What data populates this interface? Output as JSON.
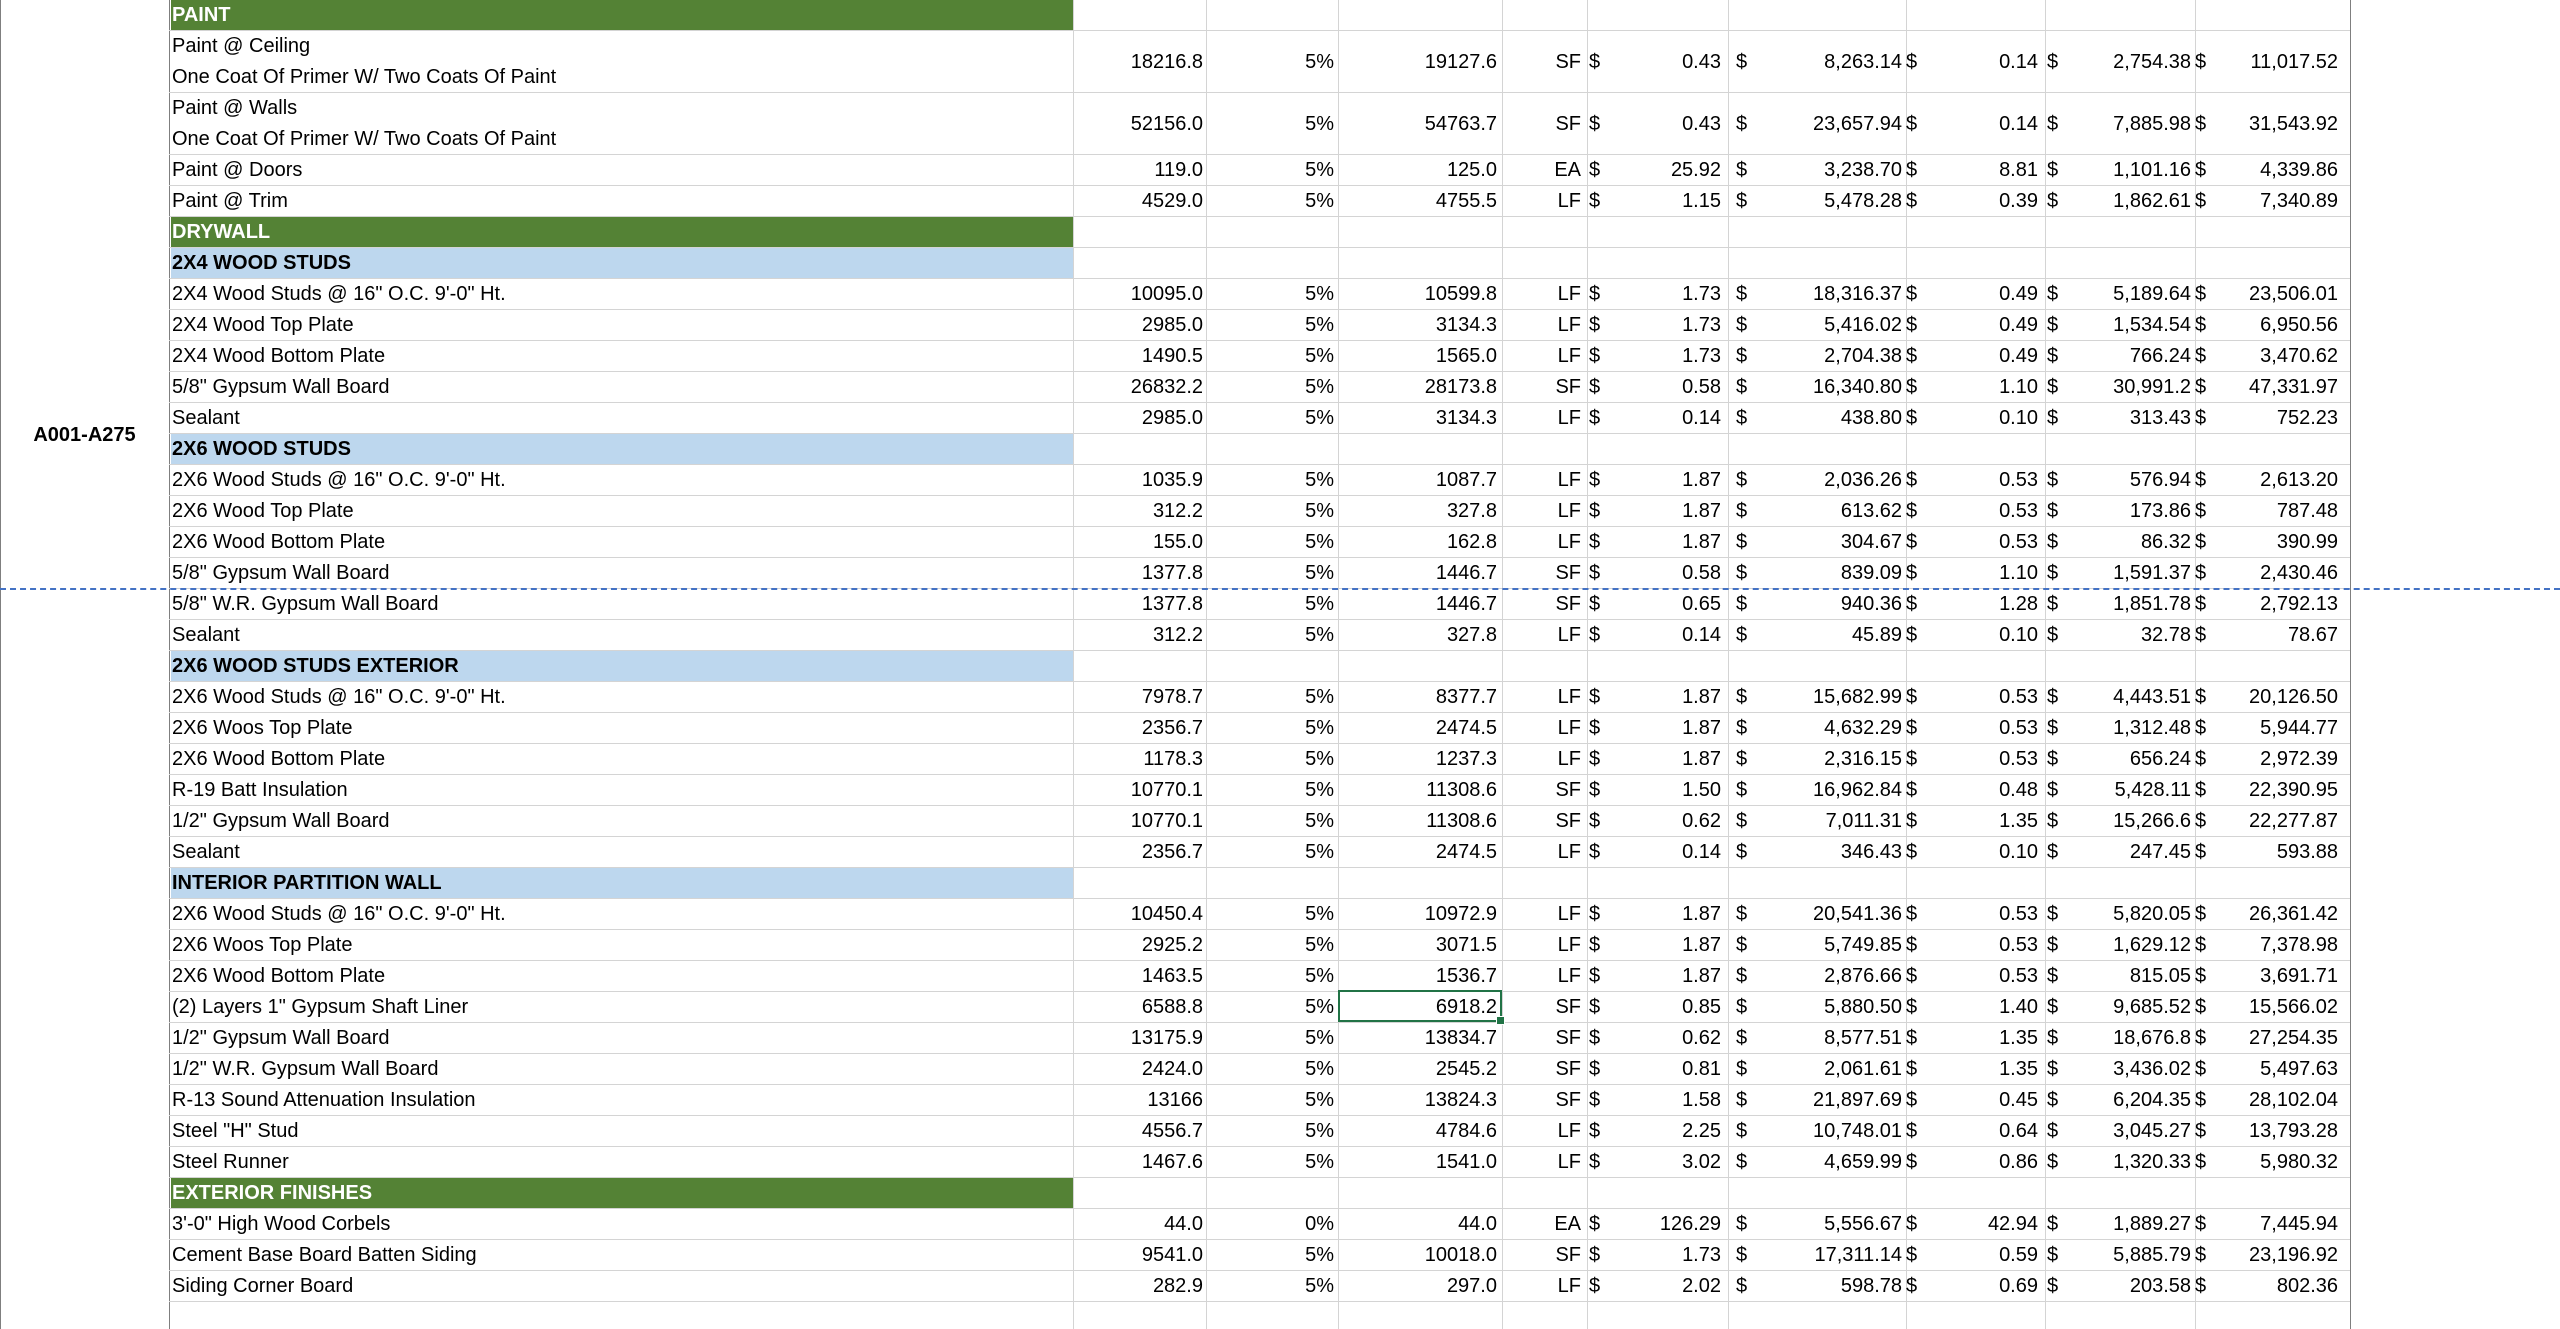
{
  "sheet": {
    "section_label": "A001-A275",
    "rows": [
      {
        "type": "header",
        "desc": "PAINT"
      },
      {
        "type": "item",
        "desc": "Paint @ Ceiling",
        "desc2": "One Coat Of Primer W/ Two Coats Of Paint",
        "qty": "18216.8",
        "waste": "5%",
        "total": "19127.6",
        "unit": "SF",
        "mat_unit": "0.43",
        "mat_total": "8,263.14",
        "lab_unit": "0.14",
        "lab_total": "2,754.38",
        "grand": "11,017.52"
      },
      {
        "type": "item",
        "desc": "Paint @ Walls",
        "desc2": "One Coat Of Primer W/ Two Coats Of Paint",
        "qty": "52156.0",
        "waste": "5%",
        "total": "54763.7",
        "unit": "SF",
        "mat_unit": "0.43",
        "mat_total": "23,657.94",
        "lab_unit": "0.14",
        "lab_total": "7,885.98",
        "grand": "31,543.92"
      },
      {
        "type": "item",
        "desc": "Paint @ Doors",
        "qty": "119.0",
        "waste": "5%",
        "total": "125.0",
        "unit": "EA",
        "mat_unit": "25.92",
        "mat_total": "3,238.70",
        "lab_unit": "8.81",
        "lab_total": "1,101.16",
        "grand": "4,339.86"
      },
      {
        "type": "item",
        "desc": "Paint @ Trim",
        "qty": "4529.0",
        "waste": "5%",
        "total": "4755.5",
        "unit": "LF",
        "mat_unit": "1.15",
        "mat_total": "5,478.28",
        "lab_unit": "0.39",
        "lab_total": "1,862.61",
        "grand": "7,340.89"
      },
      {
        "type": "header",
        "desc": "DRYWALL"
      },
      {
        "type": "sub",
        "desc": "2X4 WOOD STUDS"
      },
      {
        "type": "item",
        "desc": "2X4 Wood Studs @ 16\" O.C. 9'-0\" Ht.",
        "qty": "10095.0",
        "waste": "5%",
        "total": "10599.8",
        "unit": "LF",
        "mat_unit": "1.73",
        "mat_total": "18,316.37",
        "lab_unit": "0.49",
        "lab_total": "5,189.64",
        "grand": "23,506.01"
      },
      {
        "type": "item",
        "desc": "2X4 Wood Top Plate",
        "qty": "2985.0",
        "waste": "5%",
        "total": "3134.3",
        "unit": "LF",
        "mat_unit": "1.73",
        "mat_total": "5,416.02",
        "lab_unit": "0.49",
        "lab_total": "1,534.54",
        "grand": "6,950.56"
      },
      {
        "type": "item",
        "desc": "2X4 Wood Bottom Plate",
        "qty": "1490.5",
        "waste": "5%",
        "total": "1565.0",
        "unit": "LF",
        "mat_unit": "1.73",
        "mat_total": "2,704.38",
        "lab_unit": "0.49",
        "lab_total": "766.24",
        "grand": "3,470.62"
      },
      {
        "type": "item",
        "desc": "5/8\" Gypsum Wall Board",
        "qty": "26832.2",
        "waste": "5%",
        "total": "28173.8",
        "unit": "SF",
        "mat_unit": "0.58",
        "mat_total": "16,340.80",
        "lab_unit": "1.10",
        "lab_total": "30,991.2",
        "grand": "47,331.97"
      },
      {
        "type": "item",
        "desc": "Sealant",
        "qty": "2985.0",
        "waste": "5%",
        "total": "3134.3",
        "unit": "LF",
        "mat_unit": "0.14",
        "mat_total": "438.80",
        "lab_unit": "0.10",
        "lab_total": "313.43",
        "grand": "752.23"
      },
      {
        "type": "sub",
        "desc": "2X6 WOOD STUDS"
      },
      {
        "type": "item",
        "desc": "2X6 Wood Studs @ 16\" O.C. 9'-0\" Ht.",
        "qty": "1035.9",
        "waste": "5%",
        "total": "1087.7",
        "unit": "LF",
        "mat_unit": "1.87",
        "mat_total": "2,036.26",
        "lab_unit": "0.53",
        "lab_total": "576.94",
        "grand": "2,613.20"
      },
      {
        "type": "item",
        "desc": "2X6 Wood Top Plate",
        "qty": "312.2",
        "waste": "5%",
        "total": "327.8",
        "unit": "LF",
        "mat_unit": "1.87",
        "mat_total": "613.62",
        "lab_unit": "0.53",
        "lab_total": "173.86",
        "grand": "787.48"
      },
      {
        "type": "item",
        "desc": "2X6 Wood Bottom Plate",
        "qty": "155.0",
        "waste": "5%",
        "total": "162.8",
        "unit": "LF",
        "mat_unit": "1.87",
        "mat_total": "304.67",
        "lab_unit": "0.53",
        "lab_total": "86.32",
        "grand": "390.99"
      },
      {
        "type": "item",
        "desc": "5/8\" Gypsum Wall Board",
        "qty": "1377.8",
        "waste": "5%",
        "total": "1446.7",
        "unit": "SF",
        "mat_unit": "0.58",
        "mat_total": "839.09",
        "lab_unit": "1.10",
        "lab_total": "1,591.37",
        "grand": "2,430.46"
      },
      {
        "type": "item",
        "desc": "5/8\" W.R. Gypsum Wall Board",
        "qty": "1377.8",
        "waste": "5%",
        "total": "1446.7",
        "unit": "SF",
        "mat_unit": "0.65",
        "mat_total": "940.36",
        "lab_unit": "1.28",
        "lab_total": "1,851.78",
        "grand": "2,792.13"
      },
      {
        "type": "item",
        "desc": "Sealant",
        "qty": "312.2",
        "waste": "5%",
        "total": "327.8",
        "unit": "LF",
        "mat_unit": "0.14",
        "mat_total": "45.89",
        "lab_unit": "0.10",
        "lab_total": "32.78",
        "grand": "78.67"
      },
      {
        "type": "sub",
        "desc": "2X6 WOOD STUDS EXTERIOR"
      },
      {
        "type": "item",
        "desc": "2X6 Wood Studs @ 16\" O.C. 9'-0\" Ht.",
        "qty": "7978.7",
        "waste": "5%",
        "total": "8377.7",
        "unit": "LF",
        "mat_unit": "1.87",
        "mat_total": "15,682.99",
        "lab_unit": "0.53",
        "lab_total": "4,443.51",
        "grand": "20,126.50"
      },
      {
        "type": "item",
        "desc": "2X6 Woos Top Plate",
        "qty": "2356.7",
        "waste": "5%",
        "total": "2474.5",
        "unit": "LF",
        "mat_unit": "1.87",
        "mat_total": "4,632.29",
        "lab_unit": "0.53",
        "lab_total": "1,312.48",
        "grand": "5,944.77"
      },
      {
        "type": "item",
        "desc": "2X6 Wood Bottom Plate",
        "qty": "1178.3",
        "waste": "5%",
        "total": "1237.3",
        "unit": "LF",
        "mat_unit": "1.87",
        "mat_total": "2,316.15",
        "lab_unit": "0.53",
        "lab_total": "656.24",
        "grand": "2,972.39"
      },
      {
        "type": "item",
        "desc": "R-19 Batt Insulation",
        "qty": "10770.1",
        "waste": "5%",
        "total": "11308.6",
        "unit": "SF",
        "mat_unit": "1.50",
        "mat_total": "16,962.84",
        "lab_unit": "0.48",
        "lab_total": "5,428.11",
        "grand": "22,390.95"
      },
      {
        "type": "item",
        "desc": "1/2\" Gypsum Wall Board",
        "qty": "10770.1",
        "waste": "5%",
        "total": "11308.6",
        "unit": "SF",
        "mat_unit": "0.62",
        "mat_total": "7,011.31",
        "lab_unit": "1.35",
        "lab_total": "15,266.6",
        "grand": "22,277.87"
      },
      {
        "type": "item",
        "desc": "Sealant",
        "qty": "2356.7",
        "waste": "5%",
        "total": "2474.5",
        "unit": "LF",
        "mat_unit": "0.14",
        "mat_total": "346.43",
        "lab_unit": "0.10",
        "lab_total": "247.45",
        "grand": "593.88"
      },
      {
        "type": "sub",
        "desc": "INTERIOR PARTITION WALL"
      },
      {
        "type": "item",
        "desc": "2X6 Wood Studs @ 16\" O.C. 9'-0\" Ht.",
        "qty": "10450.4",
        "waste": "5%",
        "total": "10972.9",
        "unit": "LF",
        "mat_unit": "1.87",
        "mat_total": "20,541.36",
        "lab_unit": "0.53",
        "lab_total": "5,820.05",
        "grand": "26,361.42"
      },
      {
        "type": "item",
        "desc": "2X6 Woos Top Plate",
        "qty": "2925.2",
        "waste": "5%",
        "total": "3071.5",
        "unit": "LF",
        "mat_unit": "1.87",
        "mat_total": "5,749.85",
        "lab_unit": "0.53",
        "lab_total": "1,629.12",
        "grand": "7,378.98"
      },
      {
        "type": "item",
        "desc": "2X6 Wood Bottom Plate",
        "qty": "1463.5",
        "waste": "5%",
        "total": "1536.7",
        "unit": "LF",
        "mat_unit": "1.87",
        "mat_total": "2,876.66",
        "lab_unit": "0.53",
        "lab_total": "815.05",
        "grand": "3,691.71"
      },
      {
        "type": "item",
        "desc": "(2) Layers 1\" Gypsum Shaft Liner",
        "qty": "6588.8",
        "waste": "5%",
        "total": "6918.2",
        "unit": "SF",
        "mat_unit": "0.85",
        "mat_total": "5,880.50",
        "lab_unit": "1.40",
        "lab_total": "9,685.52",
        "grand": "15,566.02"
      },
      {
        "type": "item",
        "desc": "1/2\" Gypsum Wall Board",
        "qty": "13175.9",
        "waste": "5%",
        "total": "13834.7",
        "unit": "SF",
        "mat_unit": "0.62",
        "mat_total": "8,577.51",
        "lab_unit": "1.35",
        "lab_total": "18,676.8",
        "grand": "27,254.35"
      },
      {
        "type": "item",
        "desc": "1/2\" W.R. Gypsum Wall Board",
        "qty": "2424.0",
        "waste": "5%",
        "total": "2545.2",
        "unit": "SF",
        "mat_unit": "0.81",
        "mat_total": "2,061.61",
        "lab_unit": "1.35",
        "lab_total": "3,436.02",
        "grand": "5,497.63"
      },
      {
        "type": "item",
        "desc": "R-13 Sound Attenuation Insulation",
        "qty": "13166",
        "waste": "5%",
        "total": "13824.3",
        "unit": "SF",
        "mat_unit": "1.58",
        "mat_total": "21,897.69",
        "lab_unit": "0.45",
        "lab_total": "6,204.35",
        "grand": "28,102.04"
      },
      {
        "type": "item",
        "desc": "Steel \"H\" Stud",
        "qty": "4556.7",
        "waste": "5%",
        "total": "4784.6",
        "unit": "LF",
        "mat_unit": "2.25",
        "mat_total": "10,748.01",
        "lab_unit": "0.64",
        "lab_total": "3,045.27",
        "grand": "13,793.28"
      },
      {
        "type": "item",
        "desc": "Steel Runner",
        "qty": "1467.6",
        "waste": "5%",
        "total": "1541.0",
        "unit": "LF",
        "mat_unit": "3.02",
        "mat_total": "4,659.99",
        "lab_unit": "0.86",
        "lab_total": "1,320.33",
        "grand": "5,980.32"
      },
      {
        "type": "header",
        "desc": "EXTERIOR FINISHES"
      },
      {
        "type": "item",
        "desc": "3'-0\" High Wood Corbels",
        "qty": "44.0",
        "waste": "0%",
        "total": "44.0",
        "unit": "EA",
        "mat_unit": "126.29",
        "mat_total": "5,556.67",
        "lab_unit": "42.94",
        "lab_total": "1,889.27",
        "grand": "7,445.94"
      },
      {
        "type": "item",
        "desc": "Cement Base Board  Batten Siding",
        "qty": "9541.0",
        "waste": "5%",
        "total": "10018.0",
        "unit": "SF",
        "mat_unit": "1.73",
        "mat_total": "17,311.14",
        "lab_unit": "0.59",
        "lab_total": "5,885.79",
        "grand": "23,196.92"
      },
      {
        "type": "item",
        "desc": "Siding Corner Board",
        "qty": "282.9",
        "waste": "5%",
        "total": "297.0",
        "unit": "LF",
        "mat_unit": "2.02",
        "mat_total": "598.78",
        "lab_unit": "0.69",
        "lab_total": "203.58",
        "grand": "802.36"
      }
    ],
    "currency_symbol": "$",
    "accent_colors": {
      "header_fill": "#548235",
      "subheader_fill": "#bdd7ee",
      "selection": "#217346",
      "page_break": "#4472c4",
      "gridline": "#d4d4d4"
    }
  }
}
